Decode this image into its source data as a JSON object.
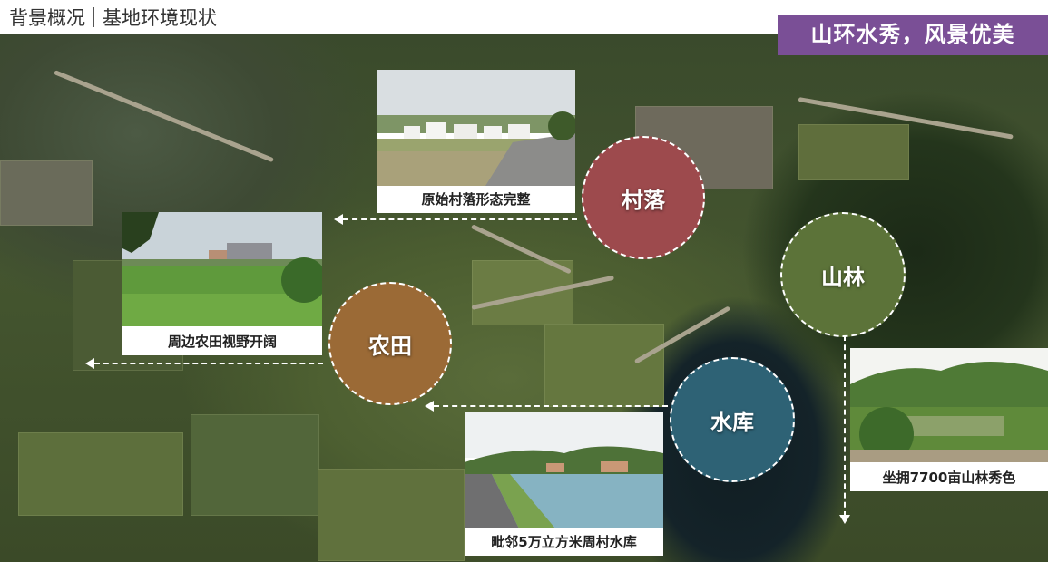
{
  "header": {
    "section": "背景概况",
    "title": "基地环境现状"
  },
  "slogan": "山环水秀，风景优美",
  "circles": {
    "village": "村落",
    "farmland": "农田",
    "forest": "山林",
    "reservoir": "水库"
  },
  "captions": {
    "village": "原始村落形态完整",
    "farmland": "周边农田视野开阔",
    "reservoir": "毗邻5万立方米周村水库",
    "forest": "坐拥7700亩山林秀色"
  },
  "colors": {
    "slogan_bg": "#7a4f96",
    "village": "#9d4a4d",
    "farmland": "#9b6a36",
    "forest": "#5c7339",
    "reservoir": "#2e6275"
  }
}
